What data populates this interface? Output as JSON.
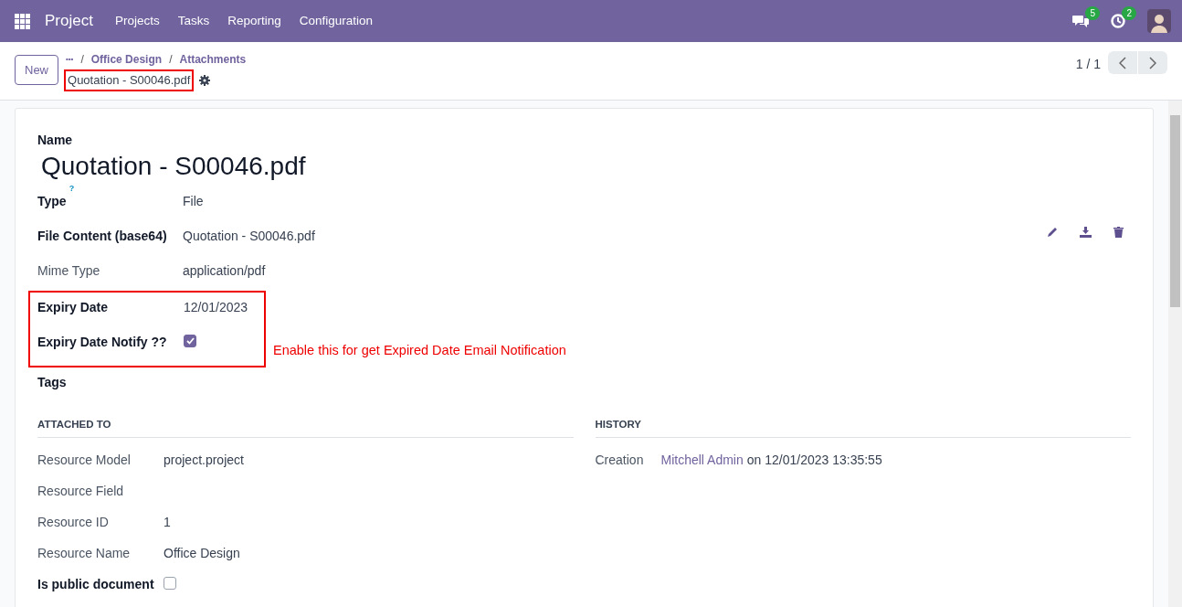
{
  "navbar": {
    "app_name": "Project",
    "menu": [
      "Projects",
      "Tasks",
      "Reporting",
      "Configuration"
    ],
    "messages_count": "5",
    "activities_count": "2"
  },
  "control_panel": {
    "new_button": "New",
    "breadcrumb_more": "•••",
    "breadcrumb_separator": "/",
    "breadcrumbs": [
      "Office Design",
      "Attachments"
    ],
    "record_title": "Quotation - S00046.pdf",
    "record_title_highlighted": true,
    "pager": "1 / 1"
  },
  "form": {
    "name_label": "Name",
    "name": "Quotation - S00046.pdf",
    "fields": [
      {
        "kind": "text",
        "label": "Type",
        "label_strong": true,
        "help": "?",
        "value": "File",
        "highlighted": false
      },
      {
        "kind": "file",
        "label": "File Content (base64)",
        "label_strong": true,
        "value": "Quotation - S00046.pdf",
        "highlighted": false
      },
      {
        "kind": "text",
        "label": "Mime Type",
        "label_strong": false,
        "value": "application/pdf",
        "highlighted": false
      },
      {
        "kind": "text",
        "label": "Expiry Date",
        "label_strong": true,
        "value": "12/01/2023",
        "highlighted": true
      },
      {
        "kind": "checkbox",
        "label": "Expiry Date Notify ??",
        "label_strong": true,
        "checked": true,
        "highlighted": true
      },
      {
        "kind": "text",
        "label": "Tags",
        "label_strong": true,
        "highlighted": false
      }
    ],
    "annotation": "Enable this for get Expired Date Email Notification",
    "attached_to": {
      "title": "ATTACHED TO",
      "fields": [
        {
          "kind": "text",
          "label": "Resource Model",
          "label_strong": false,
          "value": "project.project"
        },
        {
          "kind": "text",
          "label": "Resource Field",
          "label_strong": false
        },
        {
          "kind": "text",
          "label": "Resource ID",
          "label_strong": false,
          "value": "1"
        },
        {
          "kind": "text",
          "label": "Resource Name",
          "label_strong": false,
          "value": "Office Design"
        },
        {
          "kind": "checkbox",
          "label": "Is public document",
          "label_strong": true,
          "checked": false
        }
      ]
    },
    "history": {
      "title": "HISTORY",
      "fields": [
        {
          "kind": "link",
          "label": "Creation",
          "label_strong": false,
          "link": "Mitchell Admin",
          "value": "on 12/01/2023 13:35:55"
        }
      ]
    }
  }
}
